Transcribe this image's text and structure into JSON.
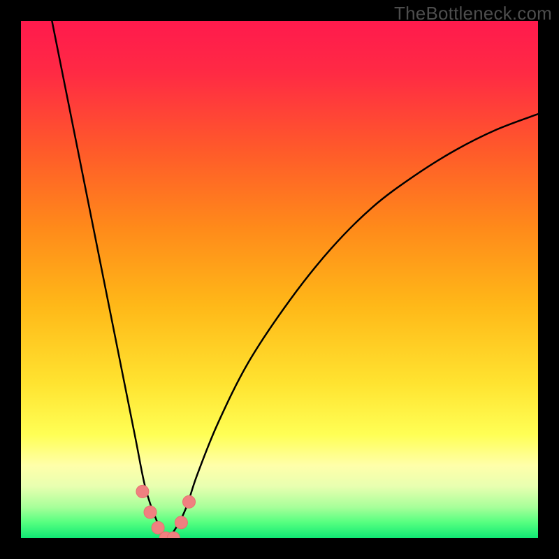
{
  "watermark": "TheBottleneck.com",
  "colors": {
    "frame": "#000000",
    "gradient_stops": [
      {
        "offset": 0.0,
        "color": "#ff1a4d"
      },
      {
        "offset": 0.1,
        "color": "#ff2a44"
      },
      {
        "offset": 0.25,
        "color": "#ff5a2a"
      },
      {
        "offset": 0.4,
        "color": "#ff8a1a"
      },
      {
        "offset": 0.55,
        "color": "#ffb818"
      },
      {
        "offset": 0.7,
        "color": "#ffe330"
      },
      {
        "offset": 0.8,
        "color": "#ffff55"
      },
      {
        "offset": 0.86,
        "color": "#ffffaa"
      },
      {
        "offset": 0.9,
        "color": "#e8ffb0"
      },
      {
        "offset": 0.94,
        "color": "#a8ff9a"
      },
      {
        "offset": 0.97,
        "color": "#55ff80"
      },
      {
        "offset": 1.0,
        "color": "#10e874"
      }
    ],
    "curve": "#000000",
    "marker_fill": "#f08080",
    "marker_stroke": "#e87070"
  },
  "chart_data": {
    "type": "line",
    "title": "",
    "xlabel": "",
    "ylabel": "",
    "xlim": [
      0,
      100
    ],
    "ylim": [
      0,
      100
    ],
    "note": "V-shaped bottleneck curve: y is mismatch/bottleneck percentage (100=worst at top, 0=best at bottom green). x is relative component performance. Minimum (optimal match) near x≈28. Values estimated from gradient position.",
    "series": [
      {
        "name": "bottleneck-curve",
        "x": [
          6,
          10,
          14,
          18,
          22,
          24,
          26,
          28,
          30,
          32,
          34,
          38,
          44,
          52,
          60,
          68,
          76,
          84,
          92,
          100
        ],
        "y": [
          100,
          80,
          60,
          40,
          20,
          10,
          4,
          0,
          2,
          6,
          12,
          22,
          34,
          46,
          56,
          64,
          70,
          75,
          79,
          82
        ]
      }
    ],
    "markers": {
      "name": "highlighted-range",
      "x": [
        23.5,
        25,
        26.5,
        28,
        29.5,
        31,
        32.5
      ],
      "y": [
        9,
        5,
        2,
        0,
        0,
        3,
        7
      ]
    }
  }
}
